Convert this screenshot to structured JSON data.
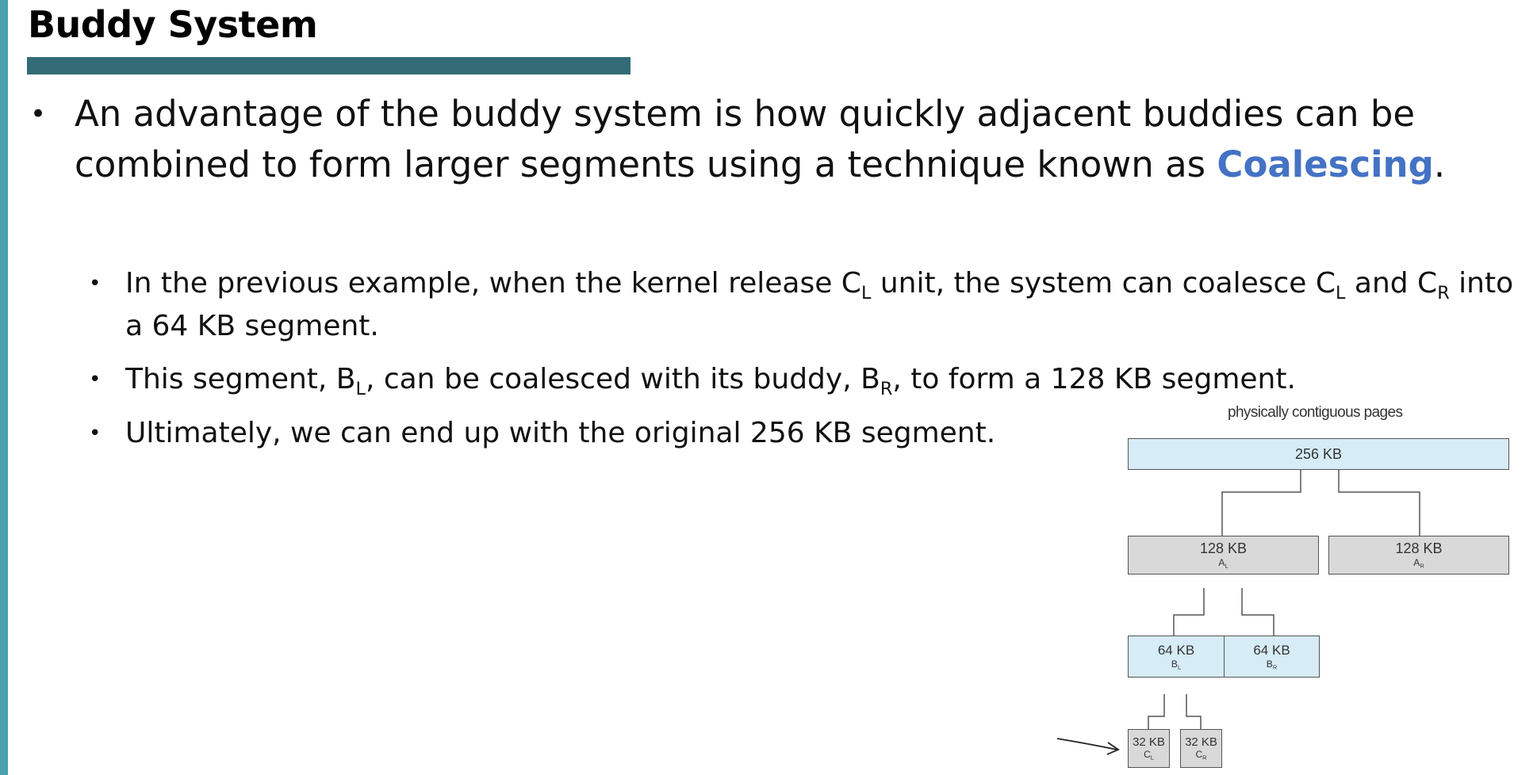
{
  "slide": {
    "title": "Buddy System",
    "accent_color": "#336b76",
    "stripe_color": "#4aa0ae"
  },
  "bullet1": {
    "text_before": "An advantage of the buddy system is how quickly adjacent buddies can be combined to form larger segments using a technique known as ",
    "highlight": "Coalescing",
    "text_after": ".",
    "highlight_color": "#4472c4"
  },
  "sub_bullets": {
    "b1": {
      "t1": "In the previous example, when the kernel release C",
      "s1": "L",
      "t2": " unit, the system can coalesce C",
      "s2": "L",
      "t3": " and C",
      "s3": "R",
      "t4": " into a 64 KB segment."
    },
    "b2": {
      "t1": "This segment, B",
      "s1": "L",
      "t2": ", can be coalesced with its buddy, B",
      "s2": "R",
      "t3": ", to form a 128 KB segment."
    },
    "b3": {
      "t1": "Ultimately, we can end up with the original 256 KB segment."
    }
  },
  "diagram": {
    "caption": "physically contiguous pages",
    "root": {
      "size": "256 KB"
    },
    "a_left": {
      "size": "128 KB",
      "label": "A",
      "sub": "L"
    },
    "a_right": {
      "size": "128 KB",
      "label": "A",
      "sub": "R"
    },
    "b_left": {
      "size": "64 KB",
      "label": "B",
      "sub": "L"
    },
    "b_right": {
      "size": "64 KB",
      "label": "B",
      "sub": "R"
    },
    "c_left": {
      "size": "32 KB",
      "label": "C",
      "sub": "L"
    },
    "c_right": {
      "size": "32 KB",
      "label": "C",
      "sub": "R"
    }
  }
}
